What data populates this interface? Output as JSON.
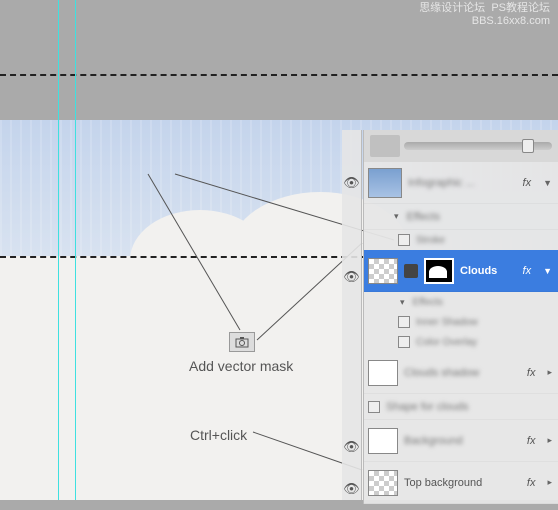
{
  "watermark": {
    "line1": "思缘设计论坛",
    "line2": "PS教程论坛",
    "line3": "BBS.16xx8.com"
  },
  "annotations": {
    "add_vector_mask": "Add vector mask",
    "ctrl_click": "Ctrl+click"
  },
  "panel": {
    "top_layer": "Infographic ...",
    "effects_label": "Effects",
    "stroke_label": "Stroke",
    "clouds": "Clouds",
    "clouds_effects": "Effects",
    "inner_shadow": "Inner Shadow",
    "color_overlay": "Color Overlay",
    "clouds_shadow": "Clouds shadow",
    "shape_for_clouds": "Shape for clouds",
    "background": "Background",
    "top_background": "Top background",
    "fx": "fx"
  }
}
